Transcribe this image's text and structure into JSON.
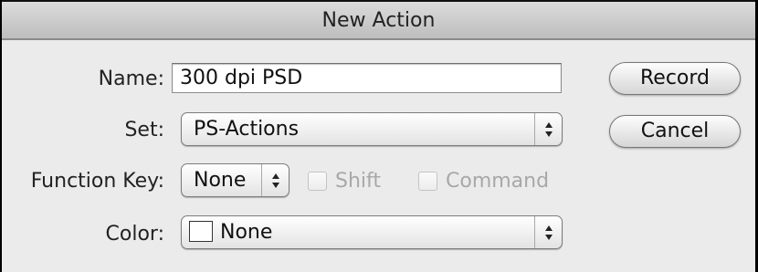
{
  "dialog": {
    "title": "New Action"
  },
  "form": {
    "name_label": "Name:",
    "name_value": "300 dpi PSD",
    "set_label": "Set:",
    "set_value": "PS-Actions",
    "function_key_label": "Function Key:",
    "function_key_value": "None",
    "shift_label": "Shift",
    "command_label": "Command",
    "color_label": "Color:",
    "color_value": "None",
    "color_swatch": "#ffffff"
  },
  "buttons": {
    "record": "Record",
    "cancel": "Cancel"
  },
  "icons": {
    "popup_arrows": "updown-arrows-icon",
    "color_swatch": "color-swatch-icon"
  }
}
